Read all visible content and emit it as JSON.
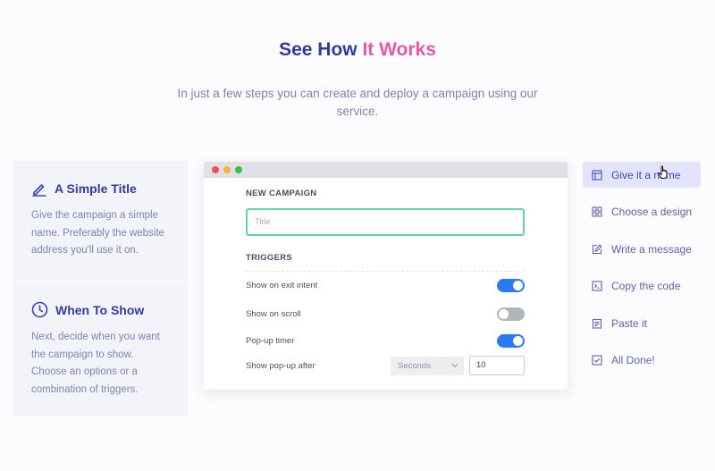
{
  "heading": {
    "part1": "See How ",
    "part2": "It Works"
  },
  "subtitle": "In just a few steps you can create and deploy a campaign using our service.",
  "cards": [
    {
      "title": "A Simple Title",
      "text": "Give the campaign a simple name. Preferably the website address you'll use it on.",
      "icon": "pencil-icon"
    },
    {
      "title": "When To Show",
      "text": "Next, decide when you want the campaign to show. Choose an options or a combination of triggers.",
      "icon": "clock-icon"
    }
  ],
  "window": {
    "new_campaign_label": "NEW CAMPAIGN",
    "title_placeholder": "Title",
    "triggers_label": "TRIGGERS",
    "triggers": [
      {
        "label": "Show on exit intent",
        "enabled": true
      },
      {
        "label": "Show on scroll",
        "enabled": false
      },
      {
        "label": "Pop-up timer",
        "enabled": true
      }
    ],
    "show_after_label": "Show pop-up after",
    "unit_selected": "Seconds",
    "delay_value": "10"
  },
  "steps": [
    {
      "label": "Give it a name",
      "icon": "layout-icon",
      "active": true
    },
    {
      "label": "Choose a design",
      "icon": "grid-icon",
      "active": false
    },
    {
      "label": "Write a message",
      "icon": "edit-icon",
      "active": false
    },
    {
      "label": "Copy the code",
      "icon": "terminal-icon",
      "active": false
    },
    {
      "label": "Paste it",
      "icon": "clipboard-icon",
      "active": false
    },
    {
      "label": "All Done!",
      "icon": "check-square-icon",
      "active": false
    }
  ],
  "colors": {
    "primary": "#343a9a",
    "accent": "#e15aa8",
    "toggle_on": "#2a7af0",
    "input_focus": "#5fd6a0"
  }
}
